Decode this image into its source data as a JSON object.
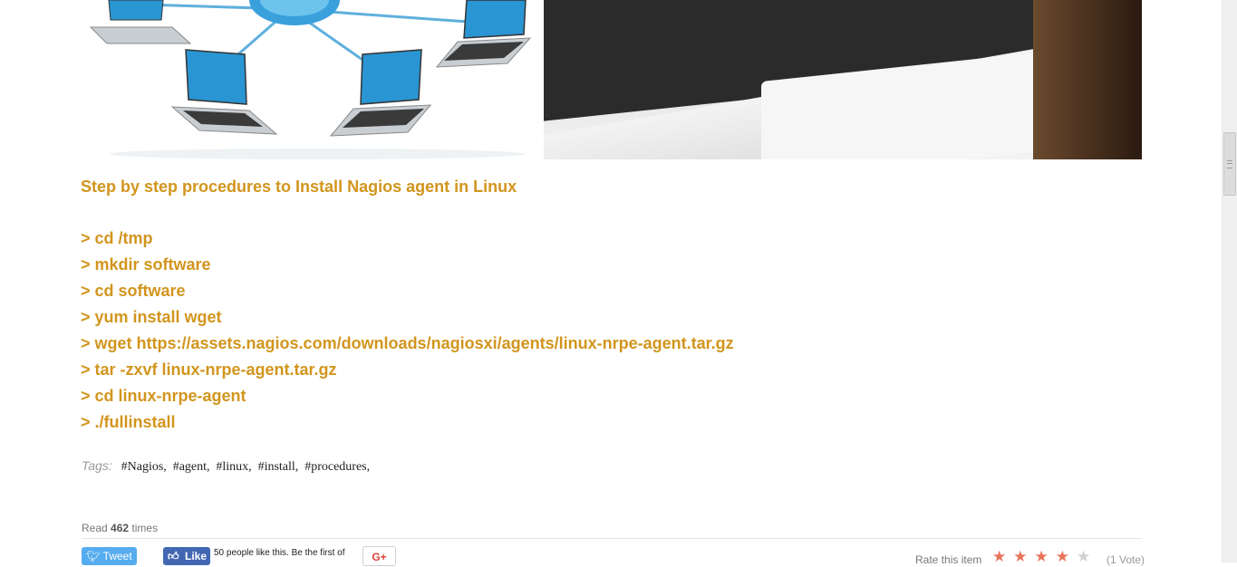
{
  "article": {
    "heading": "Step by step procedures to Install Nagios agent in Linux",
    "commands": [
      "> cd /tmp",
      "> mkdir software",
      "> cd software",
      "> yum install wget",
      "> wget https://assets.nagios.com/downloads/nagiosxi/agents/linux-nrpe-agent.tar.gz",
      "> tar -zxvf linux-nrpe-agent.tar.gz",
      "> cd linux-nrpe-agent",
      "> ./fullinstall"
    ]
  },
  "tags": {
    "label": "Tags:",
    "items": [
      "#Nagios,",
      "#agent,",
      "#linux,",
      "#install,",
      "#procedures,"
    ]
  },
  "stats": {
    "read_prefix": "Read",
    "read_count": "462",
    "read_suffix": "times"
  },
  "social": {
    "tweet_label": "Tweet",
    "like_label": "Like",
    "like_text": "50 people like this. Be the first of",
    "gplus_label": "G+"
  },
  "rating": {
    "label": "Rate this item",
    "value": 4,
    "max": 5,
    "votes": "(1 Vote)"
  },
  "colors": {
    "accent": "#d2951d",
    "star_filled": "#e8735a",
    "star_empty": "#cfcfcf",
    "tweet": "#55acee",
    "like": "#4267b2"
  }
}
